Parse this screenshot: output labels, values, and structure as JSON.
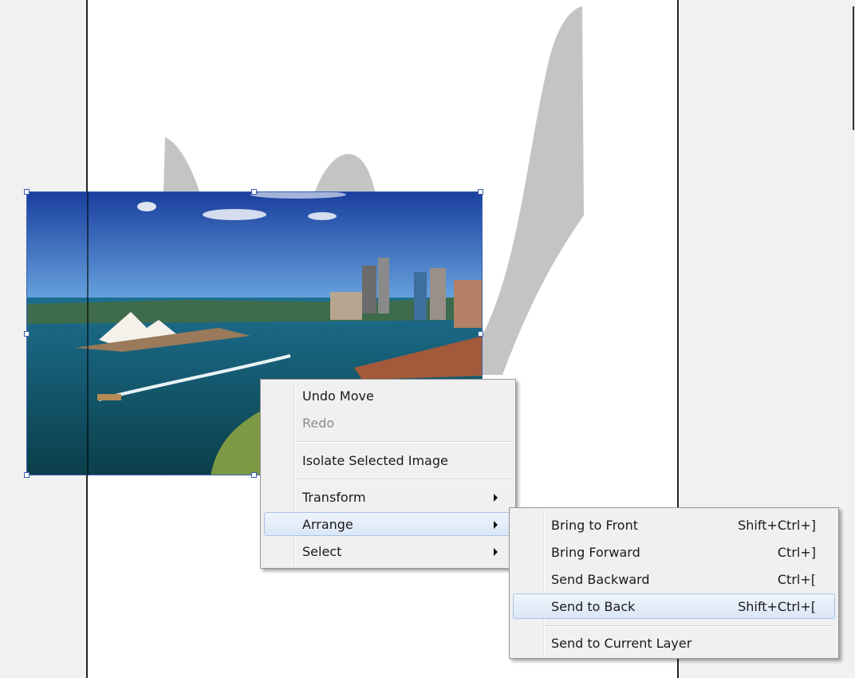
{
  "canvas": {
    "photo_description_icon": "harbour-photo"
  },
  "context_menu": {
    "items": [
      {
        "label": "Undo Move"
      },
      {
        "label": "Redo"
      },
      {
        "label": "Isolate Selected Image"
      },
      {
        "label": "Transform"
      },
      {
        "label": "Arrange"
      },
      {
        "label": "Select"
      }
    ]
  },
  "arrange_submenu": {
    "items": [
      {
        "label": "Bring to Front",
        "shortcut": "Shift+Ctrl+]"
      },
      {
        "label": "Bring Forward",
        "shortcut": "Ctrl+]"
      },
      {
        "label": "Send Backward",
        "shortcut": "Ctrl+["
      },
      {
        "label": "Send to Back",
        "shortcut": "Shift+Ctrl+["
      },
      {
        "label": "Send to Current Layer",
        "shortcut": ""
      }
    ]
  },
  "colors": {
    "selection": "#3a5fb0",
    "menu_bg": "#f0f0f0",
    "highlight": "#dbe7f6"
  }
}
